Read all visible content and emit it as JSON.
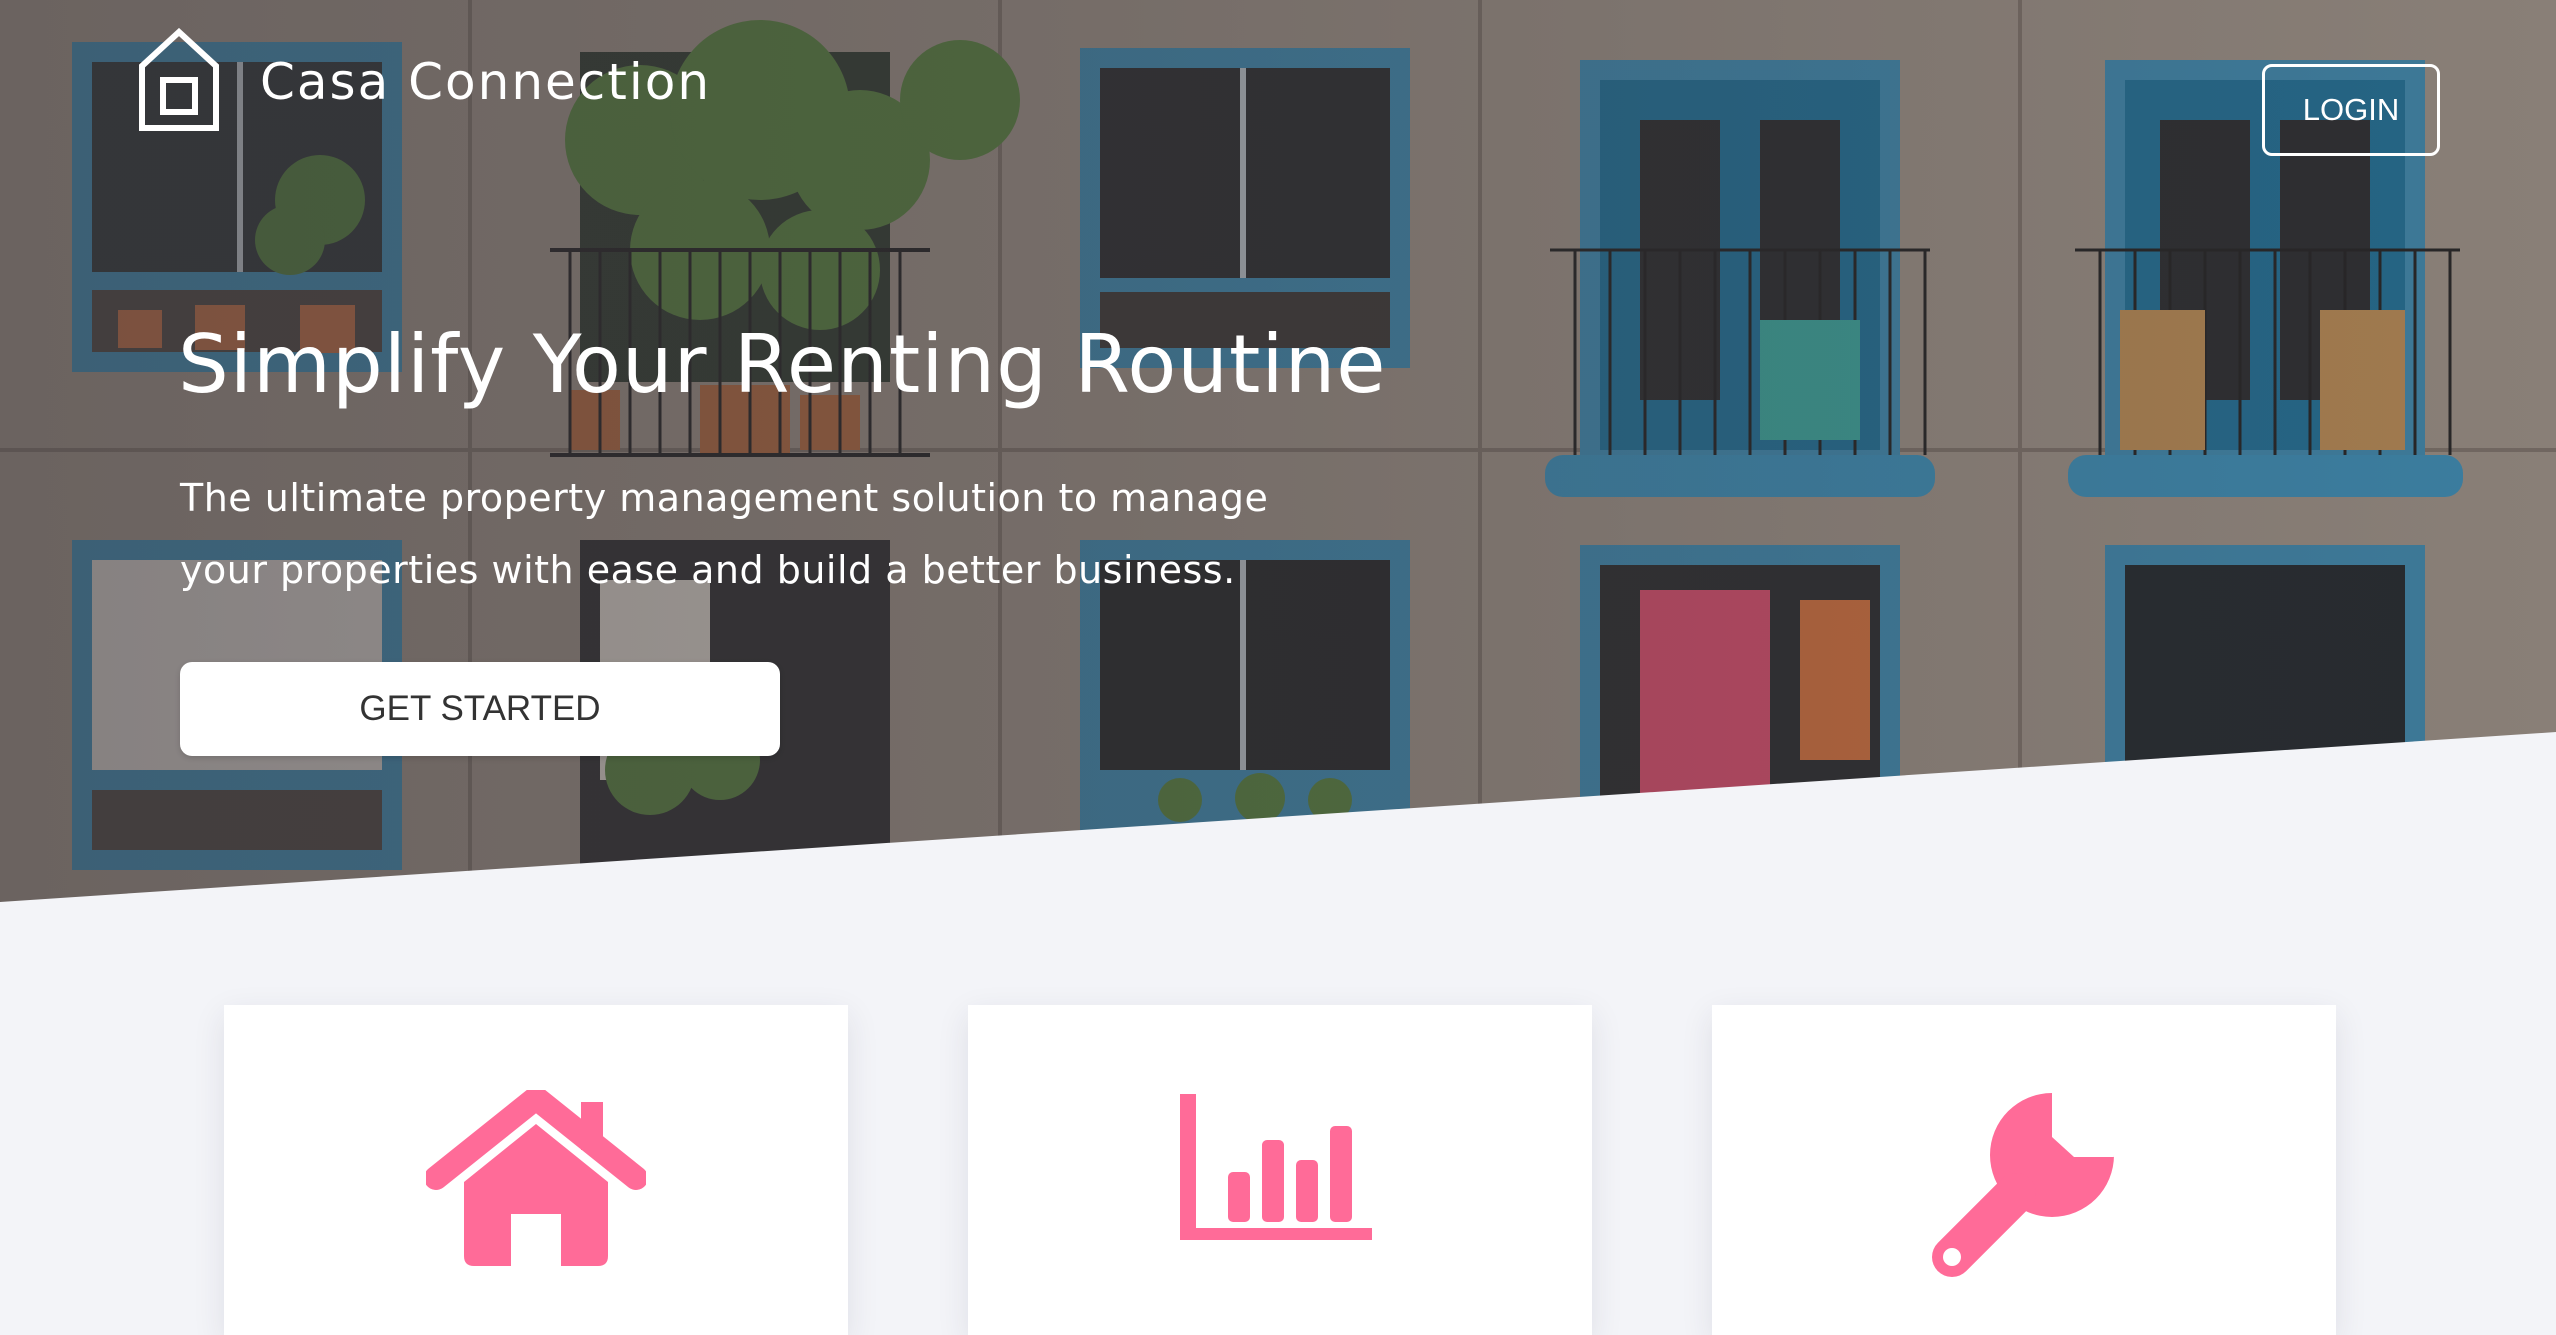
{
  "nav": {
    "brand": "Casa Connection",
    "login_label": "LOGIN"
  },
  "hero": {
    "headline": "Simplify Your Renting Routine",
    "subheadline": "The ultimate property management solution to manage your properties with ease and build a better business.",
    "cta_label": "GET STARTED",
    "background": "building-facade-with-balconies-photo"
  },
  "features": [
    {
      "icon": "house-icon"
    },
    {
      "icon": "bar-chart-icon"
    },
    {
      "icon": "wrench-icon"
    }
  ],
  "colors": {
    "accent": "#ff6b98",
    "page_background": "#f3f4f8",
    "card_background": "#ffffff",
    "window_frame": "#3d88ad"
  }
}
